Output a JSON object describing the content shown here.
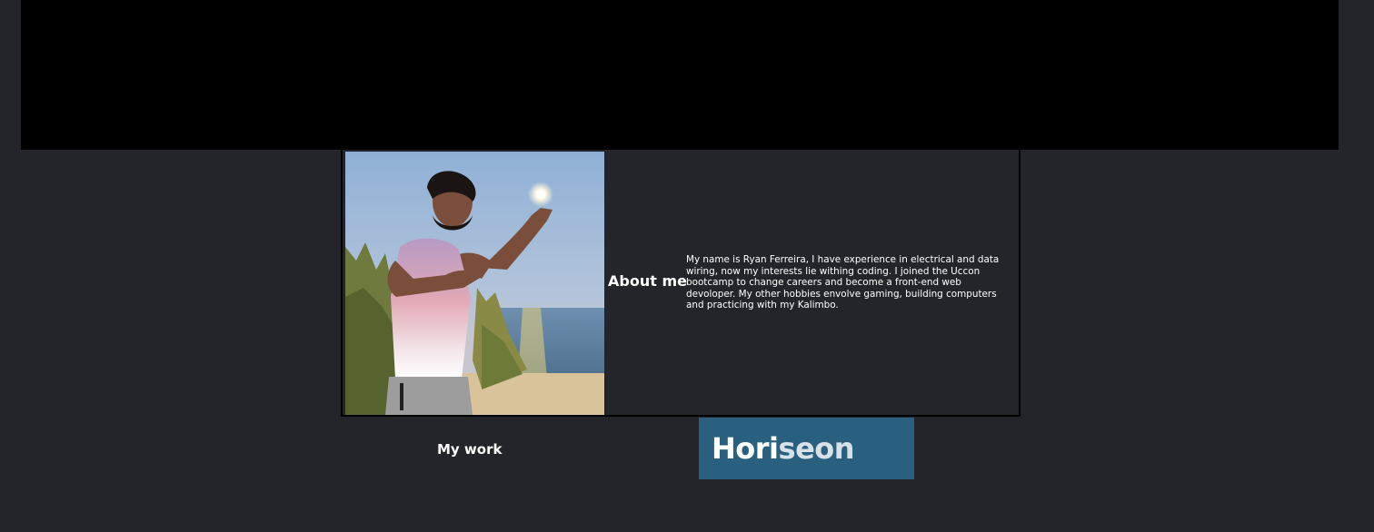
{
  "about": {
    "heading": "About me",
    "text": "My name is Ryan Ferreira, I have experience in electrical and data wiring, now my interests lie withing coding. I joined the Uccon bootcamp to change careers and become a front-end web devoloper. My other hobbies envolve gaming, building computers and practicing with my Kalimbo."
  },
  "work": {
    "heading": "My work",
    "project": {
      "brand_part1": "Hori",
      "brand_part2": "seon"
    }
  },
  "colors": {
    "page_background": "#24252b",
    "hero_background": "#000000",
    "project_card": "#2a607f"
  }
}
